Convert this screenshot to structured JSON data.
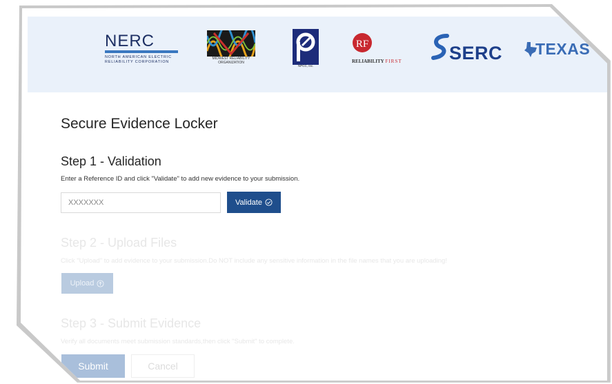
{
  "logos": {
    "nerc": {
      "name": "NERC",
      "line1": "NORTH AMERICAN ELECTRIC",
      "line2": "RELIABILITY CORPORATION"
    },
    "mro": {
      "line1": "MIDWEST RELIABILITY",
      "line2": "ORGANIZATION"
    },
    "npcc": {
      "sub": "NPCC, Inc."
    },
    "rf": {
      "mark": "RF",
      "bold": "RELIABILITY",
      "lite": "FIRST"
    },
    "serc": {
      "text": "SERC"
    },
    "texas": {
      "text": "TEXAS"
    }
  },
  "page": {
    "title": "Secure Evidence Locker"
  },
  "step1": {
    "title": "Step 1 - Validation",
    "description": "Enter a Reference ID and click \"Validate\" to add new evidence to your submission.",
    "input_placeholder": "XXXXXXX",
    "validate_label": "Validate"
  },
  "step2": {
    "title": "Step 2 - Upload Files",
    "description": "Click \"Upload\" to add evidence to your submission.Do NOT include any sensitive information in the file names that you are uploading!",
    "upload_label": "Upload"
  },
  "step3": {
    "title": "Step 3 - Submit Evidence",
    "description": "Verify all documents meet submission standards,then click \"Submit\" to complete.",
    "submit_label": "Submit",
    "cancel_label": "Cancel"
  },
  "colors": {
    "banner": "#eaf1fa",
    "primary": "#1f4e8c",
    "disabled_button": "#b9cbe0",
    "heading": "#262626"
  }
}
